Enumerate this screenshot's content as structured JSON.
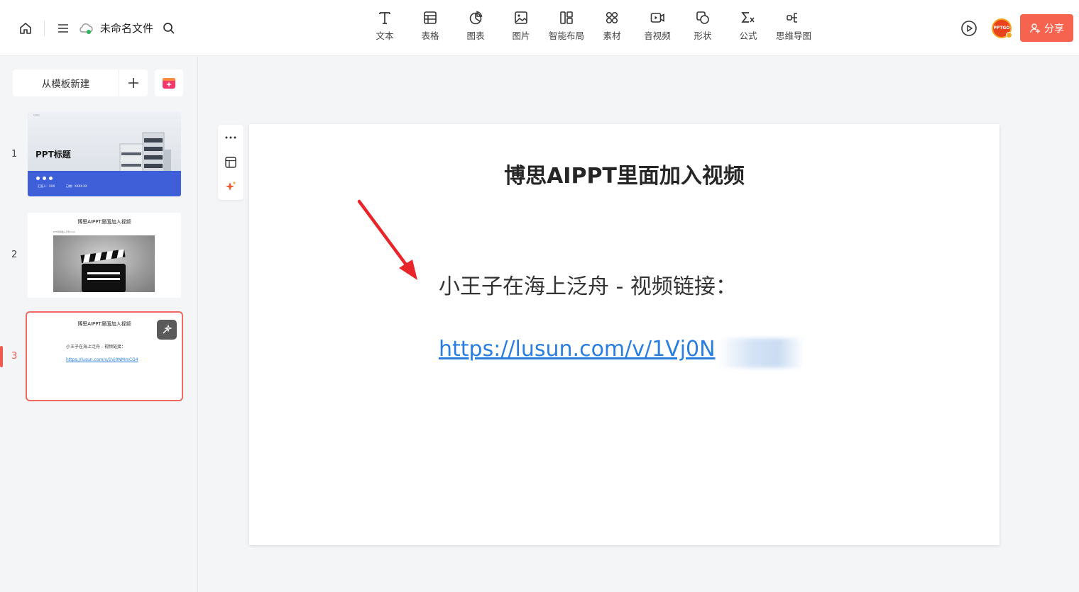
{
  "header": {
    "doc_title": "未命名文件",
    "tools": [
      {
        "label": "文本",
        "icon": "text-icon"
      },
      {
        "label": "表格",
        "icon": "table-icon"
      },
      {
        "label": "图表",
        "icon": "chart-icon"
      },
      {
        "label": "图片",
        "icon": "image-icon"
      },
      {
        "label": "智能布局",
        "icon": "smart-layout-icon"
      },
      {
        "label": "素材",
        "icon": "material-icon"
      },
      {
        "label": "音视频",
        "icon": "video-icon"
      },
      {
        "label": "形状",
        "icon": "shape-icon"
      },
      {
        "label": "公式",
        "icon": "formula-icon"
      },
      {
        "label": "思维导图",
        "icon": "mindmap-icon"
      }
    ],
    "avatar_text": "PPTGO",
    "share_label": "分享",
    "accent_color": "#f6634f"
  },
  "sidebar": {
    "new_from_template": "从模板新建",
    "slides": [
      {
        "number": "1",
        "title": "PPT标题",
        "small_left": "汇报人：XXX",
        "small_right": "日期：XXXX.XX"
      },
      {
        "number": "2",
        "title": "博思AIPPT里面加入视频",
        "sub": "PPT视频插入示例.mp4"
      },
      {
        "number": "3",
        "title": "博思AIPPT里面加入视频",
        "line": "小王子在海上泛舟 - 视频链接：",
        "link": "https://lusun.com/v/1Vj0NMmCG4"
      }
    ],
    "active_index": 3
  },
  "slide": {
    "title": "博思AIPPT里面加入视频",
    "line": "小王子在海上泛舟 - 视频链接：",
    "link": "https://lusun.com/v/1Vj0N",
    "annotation_color": "#e8262a"
  }
}
